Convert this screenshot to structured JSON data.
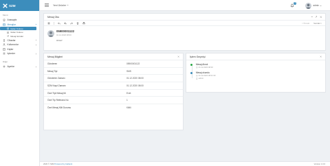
{
  "brand": {
    "name": "SZM"
  },
  "colors": {
    "accent": "#3c8dbc",
    "success": "#28a745",
    "info": "#3c8dbc"
  },
  "sidebar": {
    "menu_header": "Menü",
    "items": [
      {
        "label": "Anasayfa",
        "icon": "home-icon"
      },
      {
        "label": "Mesajlar",
        "icon": "envelope-icon",
        "active": true
      },
      {
        "label": "Cihazlar",
        "icon": "device-icon"
      },
      {
        "label": "Kullanıcılar",
        "icon": "users-icon"
      },
      {
        "label": "Kişiler",
        "icon": "contacts-icon"
      },
      {
        "label": "İşlemler",
        "icon": "operations-icon"
      }
    ],
    "sub_items": [
      {
        "label": "Gelen Kutusu",
        "icon": "inbox-icon",
        "selected": true
      },
      {
        "label": "Giden Kutusu",
        "icon": "outbox-icon"
      },
      {
        "label": "Mesaj Gönder",
        "icon": "send-icon"
      }
    ],
    "other_header": "Diğer",
    "other_items": [
      {
        "label": "Ayarlar",
        "icon": "gear-icon"
      }
    ]
  },
  "topbar": {
    "product_label": "Yeni Ürünler",
    "notification_count": "0",
    "user_name": "admin"
  },
  "message_detail": {
    "title": "Mesaj Oku",
    "toolbar_right": {
      "previous": "< Önceki",
      "next": "Sonraki >"
    },
    "sender_number": "05900001122",
    "sender_date": "01.12.2020 08:00",
    "body": "ONAY"
  },
  "message_info": {
    "title": "Mesaj Bilgileri",
    "rows": [
      {
        "key": "Gönderen",
        "value": "05900001122"
      },
      {
        "key": "Mesaj Tipi",
        "value": "SMS"
      },
      {
        "key": "Gönderim Zamanı",
        "value": "01.12.2020 08:00"
      },
      {
        "key": "SZM Kayıt Zamanı",
        "value": "01.12.2020 08:00"
      },
      {
        "key": "Özel Tipli Mesaj Mı",
        "value": "Evet"
      },
      {
        "key": "Özel Tip Referans No",
        "value": "1"
      },
      {
        "key": "Özel Mesaj Kilit Durumu",
        "value": "Kilitli"
      }
    ]
  },
  "history": {
    "title": "İşlem Geçmişi",
    "items": [
      {
        "title": "Mesaj Alındı",
        "date": "01.12.2020 08:00",
        "user": "",
        "color": "#28a745"
      },
      {
        "title": "Mesaj okundu",
        "date": "01.12.2020 08:01:30",
        "user": "admin",
        "color": "#3c8dbc"
      }
    ]
  },
  "footer": {
    "copyright": "2020 © SZM",
    "powered": "Powered by Atabank",
    "version": "Version 1.0.0"
  }
}
